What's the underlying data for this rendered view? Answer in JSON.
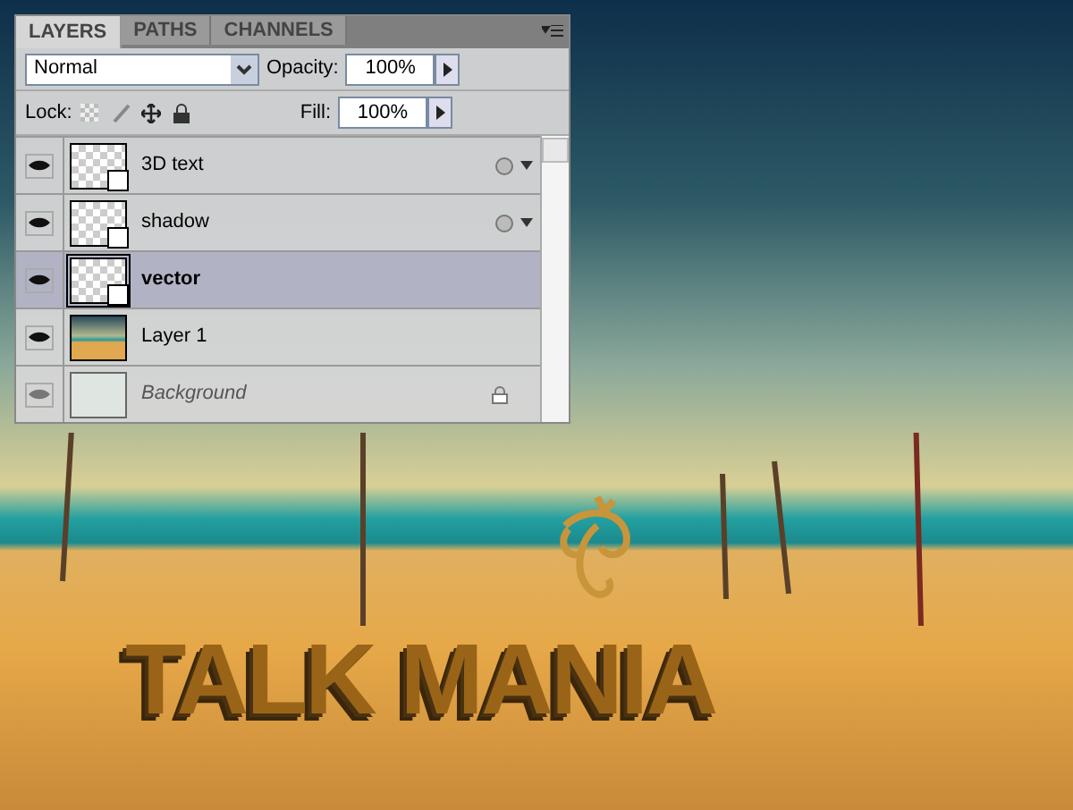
{
  "panel": {
    "tabs": [
      {
        "label": "LAYERS",
        "selected": true
      },
      {
        "label": "PATHS",
        "selected": false
      },
      {
        "label": "CHANNELS",
        "selected": false
      }
    ],
    "blend_mode": "Normal",
    "opacity_label": "Opacity:",
    "opacity": "100%",
    "lock_label": "Lock:",
    "fill_label": "Fill:",
    "fill": "100%",
    "layers": [
      {
        "name": "3D text",
        "kind": "smart",
        "visible": true,
        "selected": false,
        "effects": true,
        "locked": false
      },
      {
        "name": "shadow",
        "kind": "smart",
        "visible": true,
        "selected": false,
        "effects": true,
        "locked": false
      },
      {
        "name": "vector",
        "kind": "smart",
        "visible": true,
        "selected": true,
        "effects": false,
        "locked": false
      },
      {
        "name": "Layer 1",
        "kind": "photo",
        "visible": true,
        "selected": false,
        "effects": false,
        "locked": false
      },
      {
        "name": "Background",
        "kind": "background",
        "visible": true,
        "selected": false,
        "effects": false,
        "locked": true
      }
    ]
  },
  "canvas": {
    "title_text": "TALK MANIA"
  }
}
